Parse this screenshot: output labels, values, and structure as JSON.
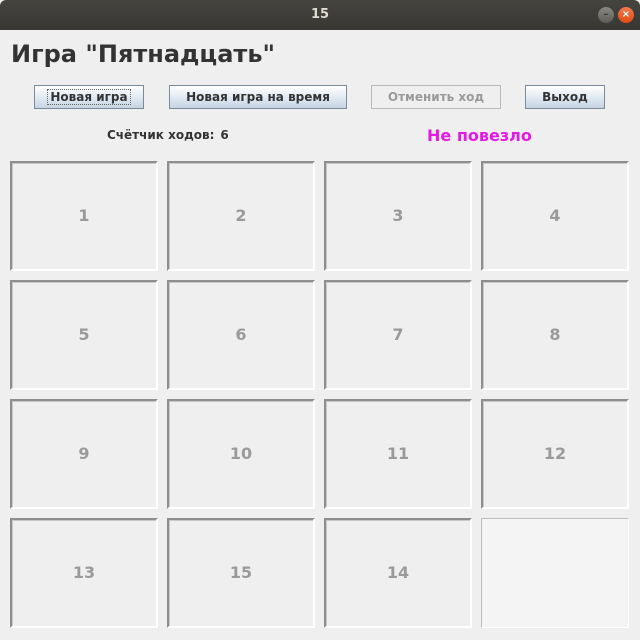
{
  "window": {
    "title": "15",
    "minimize_glyph": "–",
    "close_glyph": "×"
  },
  "game": {
    "title": "Игра \"Пятнадцать\""
  },
  "buttons": {
    "new_game": "Новая игра",
    "timed_game": "Новая игра на время",
    "undo": "Отменить ход",
    "exit": "Выход"
  },
  "counter": {
    "label": "Счётчик ходов:",
    "value": "6"
  },
  "status": {
    "text": "Не повезло",
    "color": "#e41ae4"
  },
  "board": {
    "tiles": [
      "1",
      "2",
      "3",
      "4",
      "5",
      "6",
      "7",
      "8",
      "9",
      "10",
      "11",
      "12",
      "13",
      "15",
      "14",
      ""
    ]
  }
}
